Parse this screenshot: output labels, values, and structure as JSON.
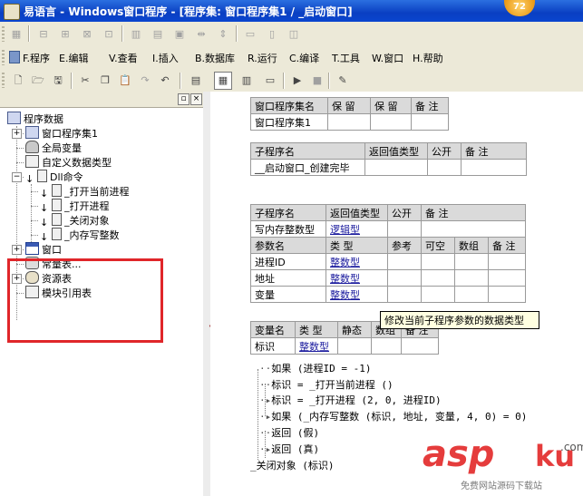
{
  "window": {
    "title": "易语言 - Windows窗口程序 - [程序集: 窗口程序集1 / _启动窗口]",
    "badge": "72"
  },
  "menu": {
    "items": [
      {
        "label": "F.程序"
      },
      {
        "label": "E.编辑"
      },
      {
        "label": "V.查看"
      },
      {
        "label": "I.插入"
      },
      {
        "label": "B.数据库"
      },
      {
        "label": "R.运行"
      },
      {
        "label": "C.编译"
      },
      {
        "label": "T.工具"
      },
      {
        "label": "W.窗口"
      },
      {
        "label": "H.帮助"
      }
    ]
  },
  "panel": {
    "root_label": "程序数据",
    "items": [
      {
        "label": "窗口程序集1",
        "expander": "+"
      },
      {
        "label": "全局变量",
        "expander": ""
      },
      {
        "label": "自定义数据类型",
        "expander": ""
      },
      {
        "label": "Dll命令",
        "expander": "−"
      },
      {
        "label": "_打开当前进程",
        "expander": ""
      },
      {
        "label": "_打开进程",
        "expander": ""
      },
      {
        "label": "_关闭对象",
        "expander": ""
      },
      {
        "label": "_内存写整数",
        "expander": ""
      },
      {
        "label": "窗口",
        "expander": "+"
      },
      {
        "label": "常量表...",
        "expander": ""
      },
      {
        "label": "资源表",
        "expander": "+"
      },
      {
        "label": "模块引用表",
        "expander": ""
      }
    ]
  },
  "editor": {
    "table1": {
      "headers": [
        "窗口程序集名",
        "保 留",
        "保 留",
        "备 注"
      ],
      "row": [
        "窗口程序集1",
        "",
        "",
        ""
      ]
    },
    "table2": {
      "headers": [
        "子程序名",
        "返回值类型",
        "公开",
        "备 注"
      ],
      "row": [
        "__启动窗口_创建完毕",
        "",
        "",
        ""
      ]
    },
    "table3": {
      "headers": [
        "子程序名",
        "返回值类型",
        "公开",
        "备 注"
      ],
      "row": [
        "写内存整数型",
        "逻辑型",
        "",
        ""
      ],
      "param_headers": [
        "参数名",
        "类 型",
        "参考",
        "可空",
        "数组",
        "备 注"
      ],
      "params": [
        [
          "进程ID",
          "整数型",
          "",
          "",
          "",
          ""
        ],
        [
          "地址",
          "整数型",
          "",
          "",
          "",
          ""
        ],
        [
          "变量",
          "整数型",
          "",
          "",
          "",
          ""
        ]
      ]
    },
    "table4": {
      "headers": [
        "变量名",
        "类 型",
        "静态",
        "数组",
        "备 注"
      ],
      "row": [
        "标识",
        "整数型",
        "",
        "",
        ""
      ]
    },
    "tooltip": "修改当前子程序参数的数据类型",
    "code": [
      "如果 (进程ID = -1)",
      "标识 = _打开当前进程 ()",
      "标识 = _打开进程 (2, 0, 进程ID)",
      "如果 (_内存写整数 (标识, 地址, 变量, 4, 0) = 0)",
      "返回 (假)",
      "返回 (真)",
      "_关闭对象 (标识)"
    ]
  },
  "watermark": {
    "brand": "asp",
    "brand2": "ku",
    "domain": ".com",
    "sub": "免费网站源码下载站"
  }
}
